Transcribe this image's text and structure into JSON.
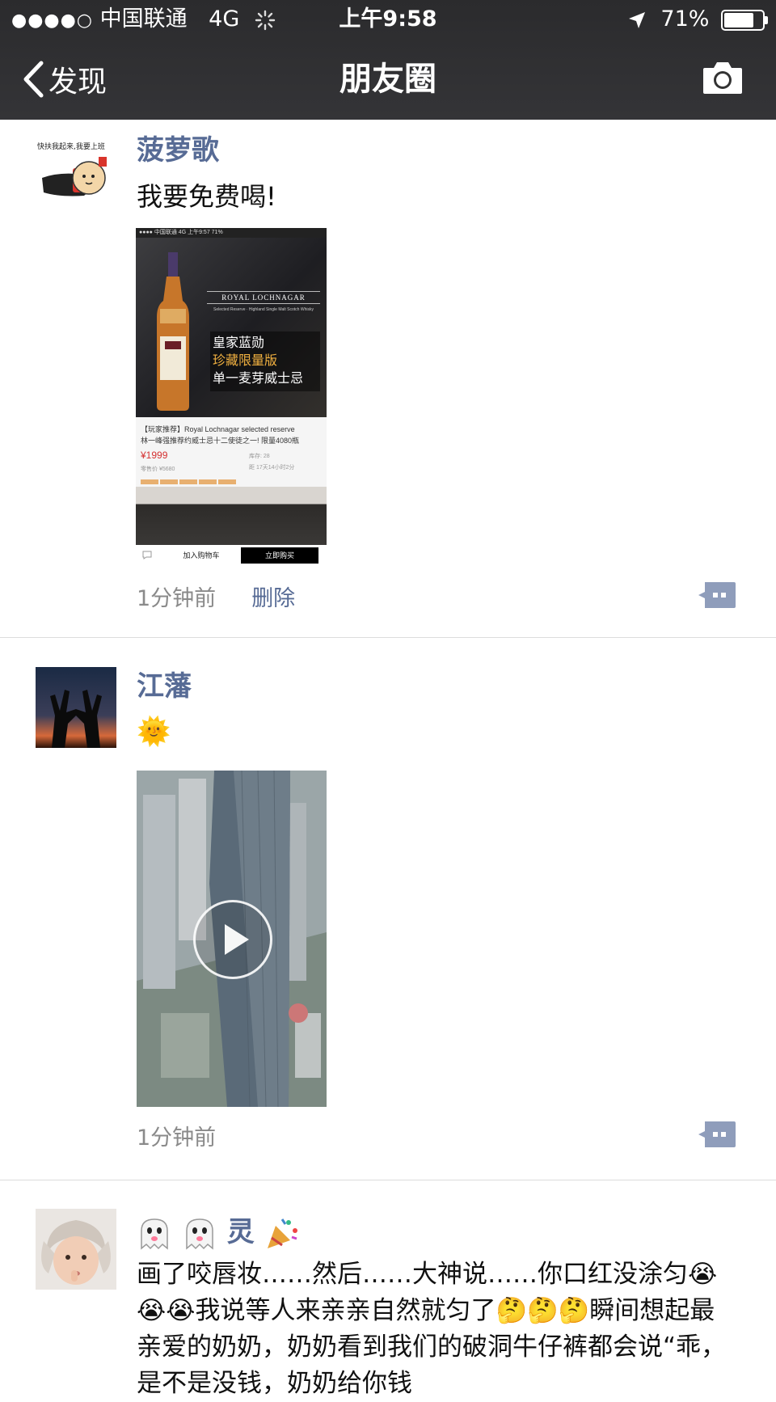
{
  "status_bar": {
    "signal_dots": "●●●●○",
    "carrier": "中国联通",
    "network": "4G",
    "time": "上午9:58",
    "battery_percent": "71%",
    "battery_level": 0.71
  },
  "nav": {
    "back_label": "发现",
    "title": "朋友圈",
    "camera_icon": "camera-icon"
  },
  "posts": [
    {
      "username": "菠萝歌",
      "avatar_caption": "快扶我起来,我要上班",
      "text": "我要免费喝!",
      "screenshot": {
        "status": "●●●● 中国联通 4G        上午9:57        71%",
        "brand": "ROYAL LOCHNAGAR",
        "brand_sub": "Selected Reserve · Highland Single Malt Scotch Whisky",
        "line1": "皇家蓝勋",
        "line2": "珍藏限量版",
        "line3": "单一麦芽威士忌",
        "desc1": "【玩家推荐】Royal Lochnagar selected reserve",
        "desc2": "林一峰强推荐约威士忌十二使徒之一! 限量4080瓶",
        "price": "¥1999",
        "original_price": "零售价 ¥5680",
        "stock": "库存: 28",
        "timer": "距 17天14小时2分",
        "cart_label": "加入购物车",
        "buy_label": "立即购买"
      },
      "time": "1分钟前",
      "delete_label": "删除"
    },
    {
      "username": "江藩",
      "text": "🌞",
      "time": "1分钟前"
    },
    {
      "username_suffix": "灵",
      "text": "画了咬唇妆……然后……大神说……你口红没涂匀😭😭😭我说等人来亲亲自然就匀了🤔🤔🤔瞬间想起最亲爱的奶奶，奶奶看到我们的破洞牛仔裤都会说“乖，是不是没钱，奶奶给你钱"
    }
  ],
  "colors": {
    "link_blue": "#576b95",
    "bar_dark": "#2f2f31"
  }
}
